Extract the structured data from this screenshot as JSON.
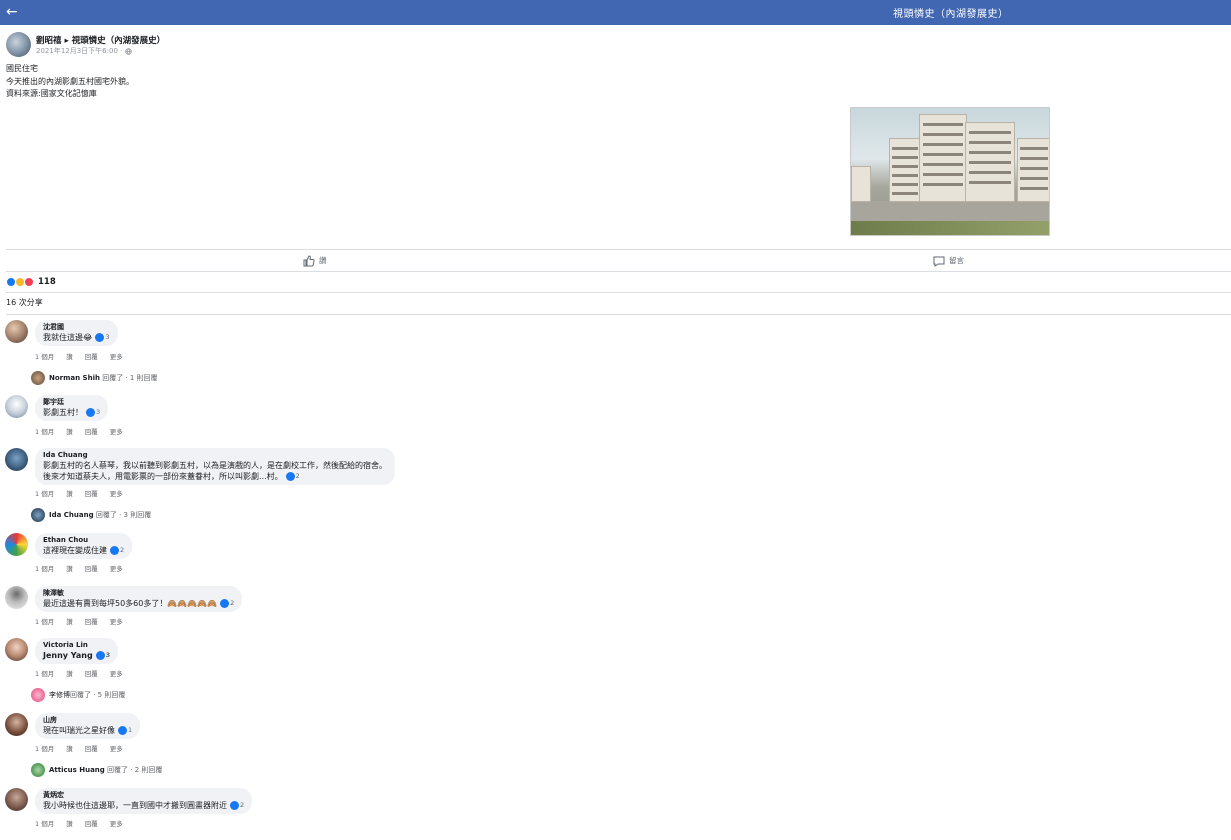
{
  "topbar": {
    "back_icon": "←",
    "title": "視頭憐史（內湖發展史）"
  },
  "post": {
    "author": "劉昭禧 ▸ 視頭憐史（內湖發展史）",
    "timestamp": "2021年12月3日下午6:00 · ",
    "privacy_icon": "globe-icon",
    "text_lines": [
      "國民住宅",
      "今天推出的內湖影劇五村國宅外貌。",
      "資料來源:國家文化記憶庫"
    ],
    "image_alt": "apartment-buildings-photo"
  },
  "actions": {
    "like_label": "讚",
    "comment_label": "留言"
  },
  "reactions": {
    "count": "118"
  },
  "shares": {
    "label": "16 次分享"
  },
  "comments": [
    {
      "name": "沈君國",
      "text": "我就住這邊😂",
      "likes": "3",
      "meta": [
        "1 個月",
        "讚",
        "回覆",
        "更多"
      ]
    },
    {
      "name": "鄭宇廷",
      "text": "影劇五村！",
      "likes": "3",
      "meta": [
        "1 個月",
        "讚",
        "回覆",
        "更多"
      ]
    },
    {
      "name": "Ida Chuang",
      "text1": "影劇五村的名人蔡琴，我以前聽到影劇五村，以為是演戲的人，是在劇校工作，然後配給的宿舍。",
      "text2": "後來才知道蔡夫人，用電影票的一部份來蓋眷村，所以叫影劇...村。",
      "likes": "2",
      "meta": [
        "1 個月",
        "讚",
        "回覆",
        "更多"
      ]
    },
    {
      "name": "Ethan Chou",
      "text": "這裡現在變成住建",
      "likes": "2",
      "meta": [
        "1 個月",
        "讚",
        "回覆",
        "更多"
      ]
    },
    {
      "name": "陳澤敏",
      "text": "最近這邊有賣到每坪50多60多了！🙈🙈🙈🙈🙈",
      "likes": "2",
      "meta": [
        "1 個月",
        "讚",
        "回覆",
        "更多"
      ]
    },
    {
      "name": "Victoria Lin",
      "text": "Jenny Yang",
      "likes": "3",
      "meta": [
        "1 個月",
        "讚",
        "回覆",
        "更多"
      ]
    },
    {
      "name": "山房",
      "text": "現在叫瑞光之星好像",
      "likes": "1",
      "meta": [
        "1 個月",
        "讚",
        "回覆",
        "更多"
      ]
    },
    {
      "name": "黃炳宏",
      "text": "我小時候也住這邊耶，一直到國中才搬到圓畫器附近",
      "likes": "2",
      "meta": [
        "1 個月",
        "讚",
        "回覆",
        "更多"
      ]
    }
  ],
  "replies": [
    {
      "name": "Norman Shih",
      "text": "回覆了 · 1 則回覆"
    },
    {
      "name": "Ida Chuang",
      "text": "回覆了 · 3 則回覆"
    },
    {
      "name": "李修博",
      "text": "回覆了 · 5 則回覆"
    },
    {
      "name": "Atticus Huang",
      "text": "回覆了 · 2 則回覆"
    }
  ]
}
